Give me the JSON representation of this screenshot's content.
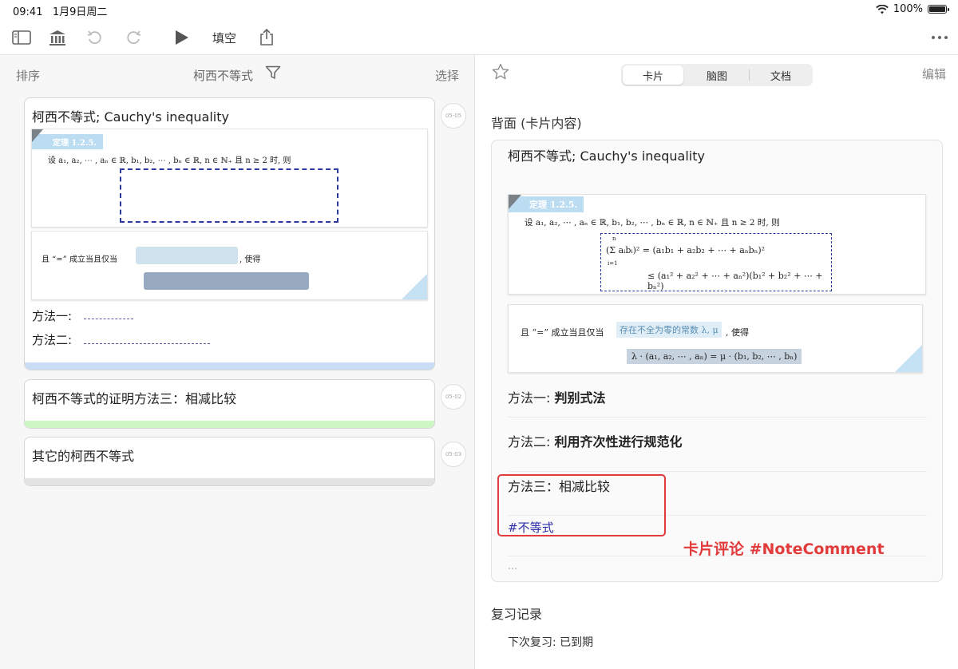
{
  "status": {
    "time": "09:41",
    "date": "1月9日周二",
    "battery": "100%"
  },
  "toolbar": {
    "cloze_label": "填空"
  },
  "left": {
    "sort_label": "排序",
    "title": "柯西不等式",
    "select_label": "选择",
    "cards": [
      {
        "title": "柯西不等式; Cauchy's inequality",
        "date": "05-05",
        "theorem_tag": "定理 1.2.5.",
        "line1": "设 a₁, a₂, ⋯ , aₙ ∈ ℝ, b₁, b₂, ⋯ , bₙ ∈ ℝ, n ∈ ℕ₊ 且 n ≥ 2 时, 则",
        "eq_line_a": "且 “=” 成立当且仅当",
        "eq_line_b": ", 使得",
        "method1": "方法一:",
        "method2": "方法二:",
        "bar_color": "#c9def5"
      },
      {
        "title": "柯西不等式的证明方法三：相减比较",
        "date": "05-02",
        "bar_color": "#cdf7c4"
      },
      {
        "title": "其它的柯西不等式",
        "date": "05-03",
        "bar_color": "#e3e3e3"
      }
    ]
  },
  "right": {
    "tabs": [
      "卡片",
      "脑图",
      "文档"
    ],
    "active_tab": "卡片",
    "edit_label": "编辑",
    "back_title": "背面 (卡片内容)",
    "card_title": "柯西不等式; Cauchy's inequality",
    "theorem_tag": "定理 1.2.5.",
    "line1": "设 a₁, a₂, ⋯ , aₙ ∈ ℝ, b₁, b₂, ⋯ , bₙ ∈ ℝ, n ∈ ℕ₊ 且 n ≥ 2 时, 则",
    "formula1": "(Σ aᵢbᵢ)² = (a₁b₁ + a₂b₂ + ⋯ + aₙbₙ)²",
    "formula_sum_top": "n",
    "formula_sum_bottom": "i=1",
    "formula2": "≤ (a₁² + a₂² + ⋯ + aₙ²)(b₁² + b₂² + ⋯ + bₙ²)",
    "eq_line_a": "且 “=” 成立当且仅当",
    "eq_highlight": "存在不全为零的常数 λ, μ",
    "eq_line_b": ", 使得",
    "eq_formula": "λ · (a₁, a₂, ⋯ , aₙ) = μ · (b₁, b₂, ⋯ , bₙ)",
    "method1_label": "方法一:",
    "method1_value": "判别式法",
    "method2_label": "方法二:",
    "method2_value": "利用齐次性进行规范化",
    "method3": "方法三：相减比较",
    "hashtag": "#不等式",
    "ellipsis": "...",
    "annotation": "卡片评论 #NoteComment",
    "review_title": "复习记录",
    "next_review": "下次复习: 已到期"
  }
}
